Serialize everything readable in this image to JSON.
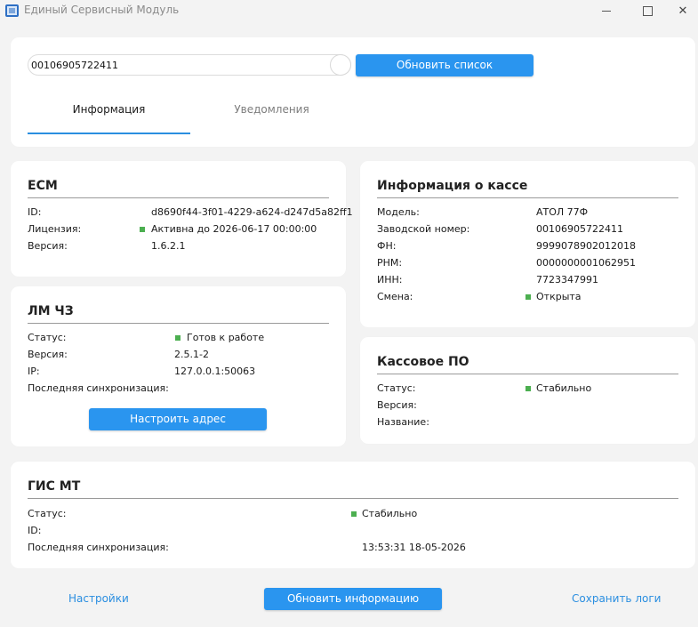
{
  "window": {
    "title": "Единый Сервисный Модуль"
  },
  "top": {
    "search_value": "00106905722411",
    "refresh_label": "Обновить список",
    "tabs": [
      {
        "label": "Информация",
        "active": true
      },
      {
        "label": "Уведомления",
        "active": false
      }
    ]
  },
  "ecm": {
    "title": "ЕСМ",
    "rows": [
      {
        "label": "ID:",
        "value": "d8690f44-3f01-4229-a624-d247d5a82ff1"
      },
      {
        "label": "Лицензия:",
        "value": "Активна до 2026-06-17 00:00:00"
      },
      {
        "label": "Версия:",
        "value": "1.6.2.1"
      }
    ]
  },
  "lm": {
    "title": "ЛМ ЧЗ",
    "rows": [
      {
        "label": "Статус:",
        "value": "Готов к работе"
      },
      {
        "label": "Версия:",
        "value": "2.5.1-2"
      },
      {
        "label": "IP:",
        "value": "127.0.0.1:50063"
      },
      {
        "label": "Последняя синхронизация:",
        "value": ""
      }
    ],
    "button_label": "Настроить адрес"
  },
  "kassa": {
    "title": "Информация о кассе",
    "rows": [
      {
        "label": "Модель:",
        "value": "АТОЛ 77Ф"
      },
      {
        "label": "Заводской номер:",
        "value": "00106905722411"
      },
      {
        "label": "ФН:",
        "value": "9999078902012018"
      },
      {
        "label": "РНМ:",
        "value": "0000000001062951"
      },
      {
        "label": "ИНН:",
        "value": "7723347991"
      },
      {
        "label": "Смена:",
        "value": "Открыта"
      }
    ]
  },
  "po": {
    "title": "Кассовое ПО",
    "rows": [
      {
        "label": "Статус:",
        "value": "Стабильно"
      },
      {
        "label": "Версия:",
        "value": ""
      },
      {
        "label": "Название:",
        "value": ""
      }
    ]
  },
  "gis": {
    "title": "ГИС МТ",
    "rows": [
      {
        "label": "Статус:",
        "value": "Стабильно"
      },
      {
        "label": "ID:",
        "value": ""
      },
      {
        "label": "Последняя синхронизация:",
        "value": "13:53:31 18-05-2026"
      }
    ]
  },
  "footer": {
    "settings_label": "Настройки",
    "update_label": "Обновить информацию",
    "save_logs_label": "Сохранить логи"
  },
  "colors": {
    "accent": "#2a95ef",
    "link": "#2a8ee0",
    "status_ok": "#4caf50"
  },
  "icons": {
    "app": "app-logo-icon",
    "status": "status-square-icon"
  }
}
